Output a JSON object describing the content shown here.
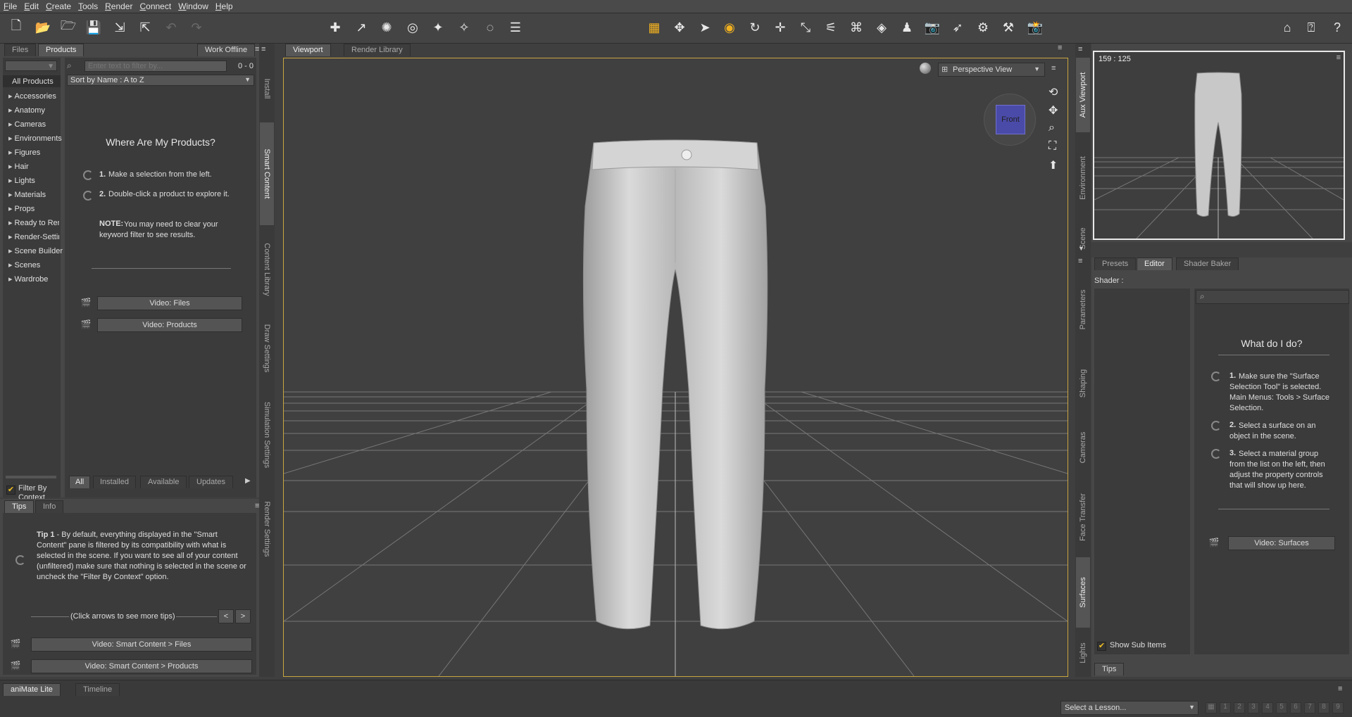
{
  "menu": [
    "File",
    "Edit",
    "Create",
    "Tools",
    "Render",
    "Connect",
    "Window",
    "Help"
  ],
  "left_panel": {
    "tabs": [
      "Files",
      "Products"
    ],
    "work_offline": "Work Offline",
    "filter_placeholder": "Enter text to filter by...",
    "count": "0 - 0",
    "sort": "Sort by Name : A to Z",
    "all_products": "All Products",
    "categories": [
      "Accessories",
      "Anatomy",
      "Cameras",
      "Environments",
      "Figures",
      "Hair",
      "Lights",
      "Materials",
      "Props",
      "Ready to Render",
      "Render-Settings",
      "Scene Builder",
      "Scenes",
      "Wardrobe"
    ],
    "where_title": "Where Are My Products?",
    "step1_num": "1.",
    "step1": "Make a selection from the left.",
    "step2_num": "2.",
    "step2": "Double-click a product to explore it.",
    "note_label": "NOTE:",
    "note": "You may need to clear your keyword filter to see results.",
    "video_files": "Video: Files",
    "video_products": "Video: Products",
    "filter_by_context": "Filter By Context",
    "bottom_tabs": [
      "All",
      "Installed",
      "Available",
      "Updates"
    ],
    "side_tabs": [
      "Install",
      "Smart Content",
      "Content Library",
      "Draw Settings",
      "Simulation Settings",
      "Render Settings"
    ]
  },
  "tips_panel": {
    "tabs": [
      "Tips",
      "Info"
    ],
    "tip_label": "Tip 1",
    "tip_text": " - By default, everything displayed in the \"Smart Content\" pane is filtered by its compatibility with what is selected in the scene. If you want to see all of your content (unfiltered) make sure that nothing is selected in the scene or uncheck the \"Filter By Context\" option.",
    "arrows_hint": "(Click arrows to see more tips)",
    "prev": "<",
    "next": ">",
    "video1": "Video: Smart Content > Files",
    "video2": "Video: Smart Content > Products"
  },
  "viewport": {
    "tabs": [
      "Viewport",
      "Render Library"
    ],
    "view_mode": "Perspective View",
    "cube_label": "Front"
  },
  "aux": {
    "ratio": "159 : 125",
    "side_tabs": [
      "Aux Viewport",
      "Environment",
      "Scene"
    ]
  },
  "surfaces": {
    "tabs": [
      "Presets",
      "Editor",
      "Shader Baker"
    ],
    "shader_label": "Shader :",
    "what_title": "What do I do?",
    "s1_num": "1.",
    "s1": "Make sure the \"Surface Selection Tool\" is selected. Main Menus: Tools > Surface Selection.",
    "s2_num": "2.",
    "s2": "Select a surface on an object in the scene.",
    "s3_num": "3.",
    "s3": "Select a material group from the list on the left, then adjust the property controls that will show up here.",
    "video": "Video: Surfaces",
    "show_sub_items": "Show Sub Items",
    "tips_tab": "Tips",
    "side_tabs": [
      "Parameters",
      "Shaping",
      "Cameras",
      "Face Transfer",
      "Surfaces",
      "Lights"
    ]
  },
  "bottom": {
    "tabs": [
      "aniMate Lite",
      "Timeline"
    ],
    "lesson": "Select a Lesson...",
    "pages": [
      "1",
      "2",
      "3",
      "4",
      "5",
      "6",
      "7",
      "8",
      "9"
    ]
  },
  "colors": {
    "accent": "#c9a640",
    "background": "#3f3f3f",
    "panel": "#474747"
  }
}
